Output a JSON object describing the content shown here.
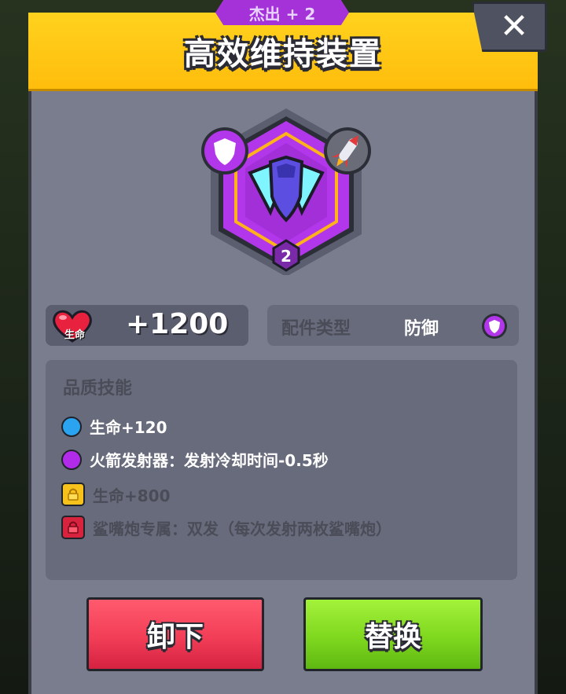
{
  "header": {
    "rarity_tag": "杰出 + 2",
    "title": "高效维持装置",
    "close_label": "✕"
  },
  "item": {
    "level": "2",
    "frame_color": "#a432d8",
    "inner_icon": "crystal-shield-icon",
    "badge_left": "shield-icon",
    "badge_right": "rocket-icon"
  },
  "stats": {
    "life_label": "生命",
    "life_value": "+1200",
    "type_label": "配件类型",
    "type_value": "防御"
  },
  "skills": {
    "title": "品质技能",
    "items": [
      {
        "text": "生命+120",
        "marker": "blue-dot",
        "color": "#2aa3f0",
        "unlocked": true
      },
      {
        "text": "火箭发射器：发射冷却时间-0.5秒",
        "marker": "purple-dot",
        "color": "#b12be8",
        "unlocked": true
      },
      {
        "text": "生命+800",
        "marker": "yellow-lock",
        "color": "#f7c21c",
        "unlocked": false
      },
      {
        "text": "鲨嘴炮专属：双发（每次发射两枚鲨嘴炮）",
        "marker": "red-lock",
        "color": "#d8233f",
        "unlocked": false
      }
    ]
  },
  "buttons": {
    "unequip": "卸下",
    "replace": "替换"
  }
}
